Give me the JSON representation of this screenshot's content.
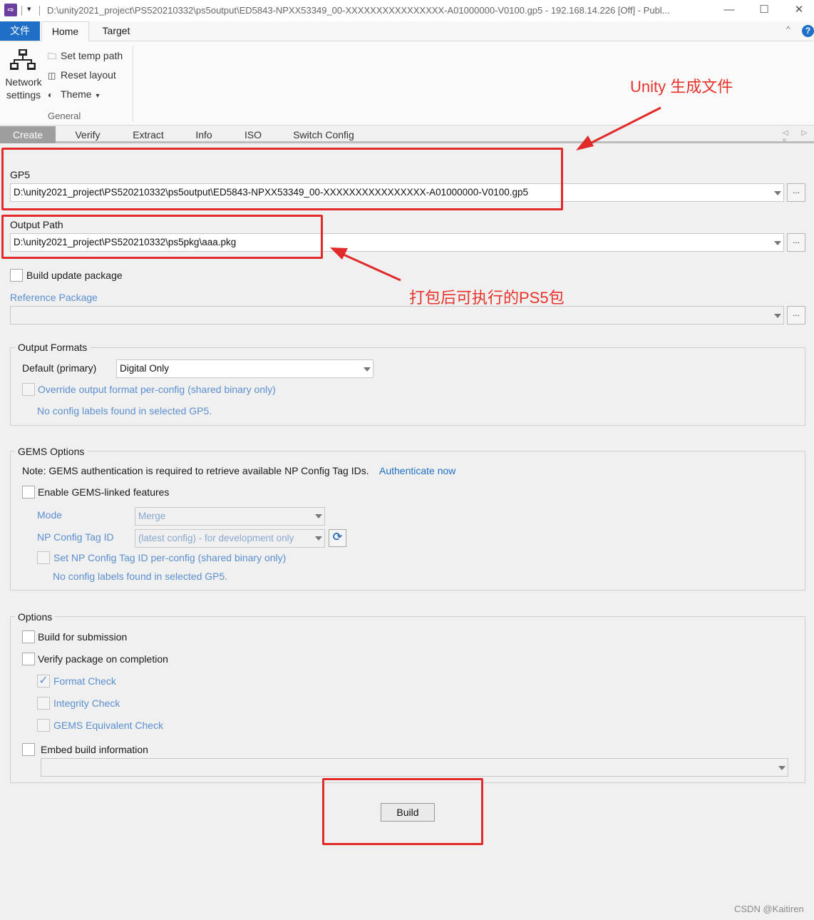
{
  "titlebar": {
    "app_icon": "app-logo",
    "dropdown": "▾",
    "title": "D:\\unity2021_project\\PS520210332\\ps5output\\ED5843-NPXX53349_00-XXXXXXXXXXXXXXXX-A01000000-V0100.gp5 - 192.168.14.226 [Off] - Publ...",
    "minimize": "—",
    "maximize": "☐",
    "close": "✕"
  },
  "ribbon": {
    "tabs": {
      "file": "文件",
      "home": "Home",
      "target": "Target"
    },
    "collapse": "^",
    "help": "?",
    "network_label_1": "Network",
    "network_label_2": "settings",
    "items": {
      "set_temp_path": "Set temp path",
      "reset_layout": "Reset layout",
      "theme": "Theme",
      "theme_caret": "▾"
    },
    "group_label": "General"
  },
  "doc_tabs": {
    "create": "Create",
    "verify": "Verify",
    "extract": "Extract",
    "info": "Info",
    "iso": "ISO",
    "switch_config": "Switch Config",
    "nav": "◁ ▷ ▿"
  },
  "gp5": {
    "label": "GP5",
    "value": "D:\\unity2021_project\\PS520210332\\ps5output\\ED5843-NPXX53349_00-XXXXXXXXXXXXXXXX-A01000000-V0100.gp5",
    "browse": "..."
  },
  "output_path": {
    "label": "Output Path",
    "value": "D:\\unity2021_project\\PS520210332\\ps5pkg\\aaa.pkg",
    "browse": "..."
  },
  "build_update": {
    "label": "Build update package"
  },
  "reference_package": {
    "label": "Reference Package",
    "value": "",
    "browse": "..."
  },
  "output_formats": {
    "title": "Output Formats",
    "default_label": "Default (primary)",
    "default_value": "Digital Only",
    "override_label": "Override output format per-config (shared binary only)",
    "no_config": "No config labels found in selected GP5."
  },
  "gems": {
    "title": "GEMS Options",
    "note": "Note: GEMS authentication is required to retrieve available NP Config Tag IDs.",
    "auth_link": "Authenticate now",
    "enable_label": "Enable GEMS-linked features",
    "mode_label": "Mode",
    "mode_value": "Merge",
    "np_tag_label": "NP Config Tag ID",
    "np_tag_value": "(latest config) - for development only",
    "refresh": "⟳",
    "set_np_label": "Set NP Config Tag ID per-config (shared binary only)",
    "no_config": "No config labels found in selected GP5."
  },
  "options": {
    "title": "Options",
    "build_submission": "Build for submission",
    "verify_completion": "Verify package on completion",
    "format_check": "Format Check",
    "format_check_mark": "✓",
    "integrity_check": "Integrity Check",
    "gems_check": "GEMS Equivalent Check",
    "embed_build": "Embed build information",
    "embed_value": ""
  },
  "build_button": "Build",
  "annotations": {
    "unity": "Unity 生成文件",
    "ps5": "打包后可执行的PS5包"
  },
  "watermark": "CSDN @Kaitiren",
  "colors": {
    "accent": "#1f6fc6",
    "annotation_red": "#e12a2a",
    "disabled_text": "#5b8fd0"
  }
}
